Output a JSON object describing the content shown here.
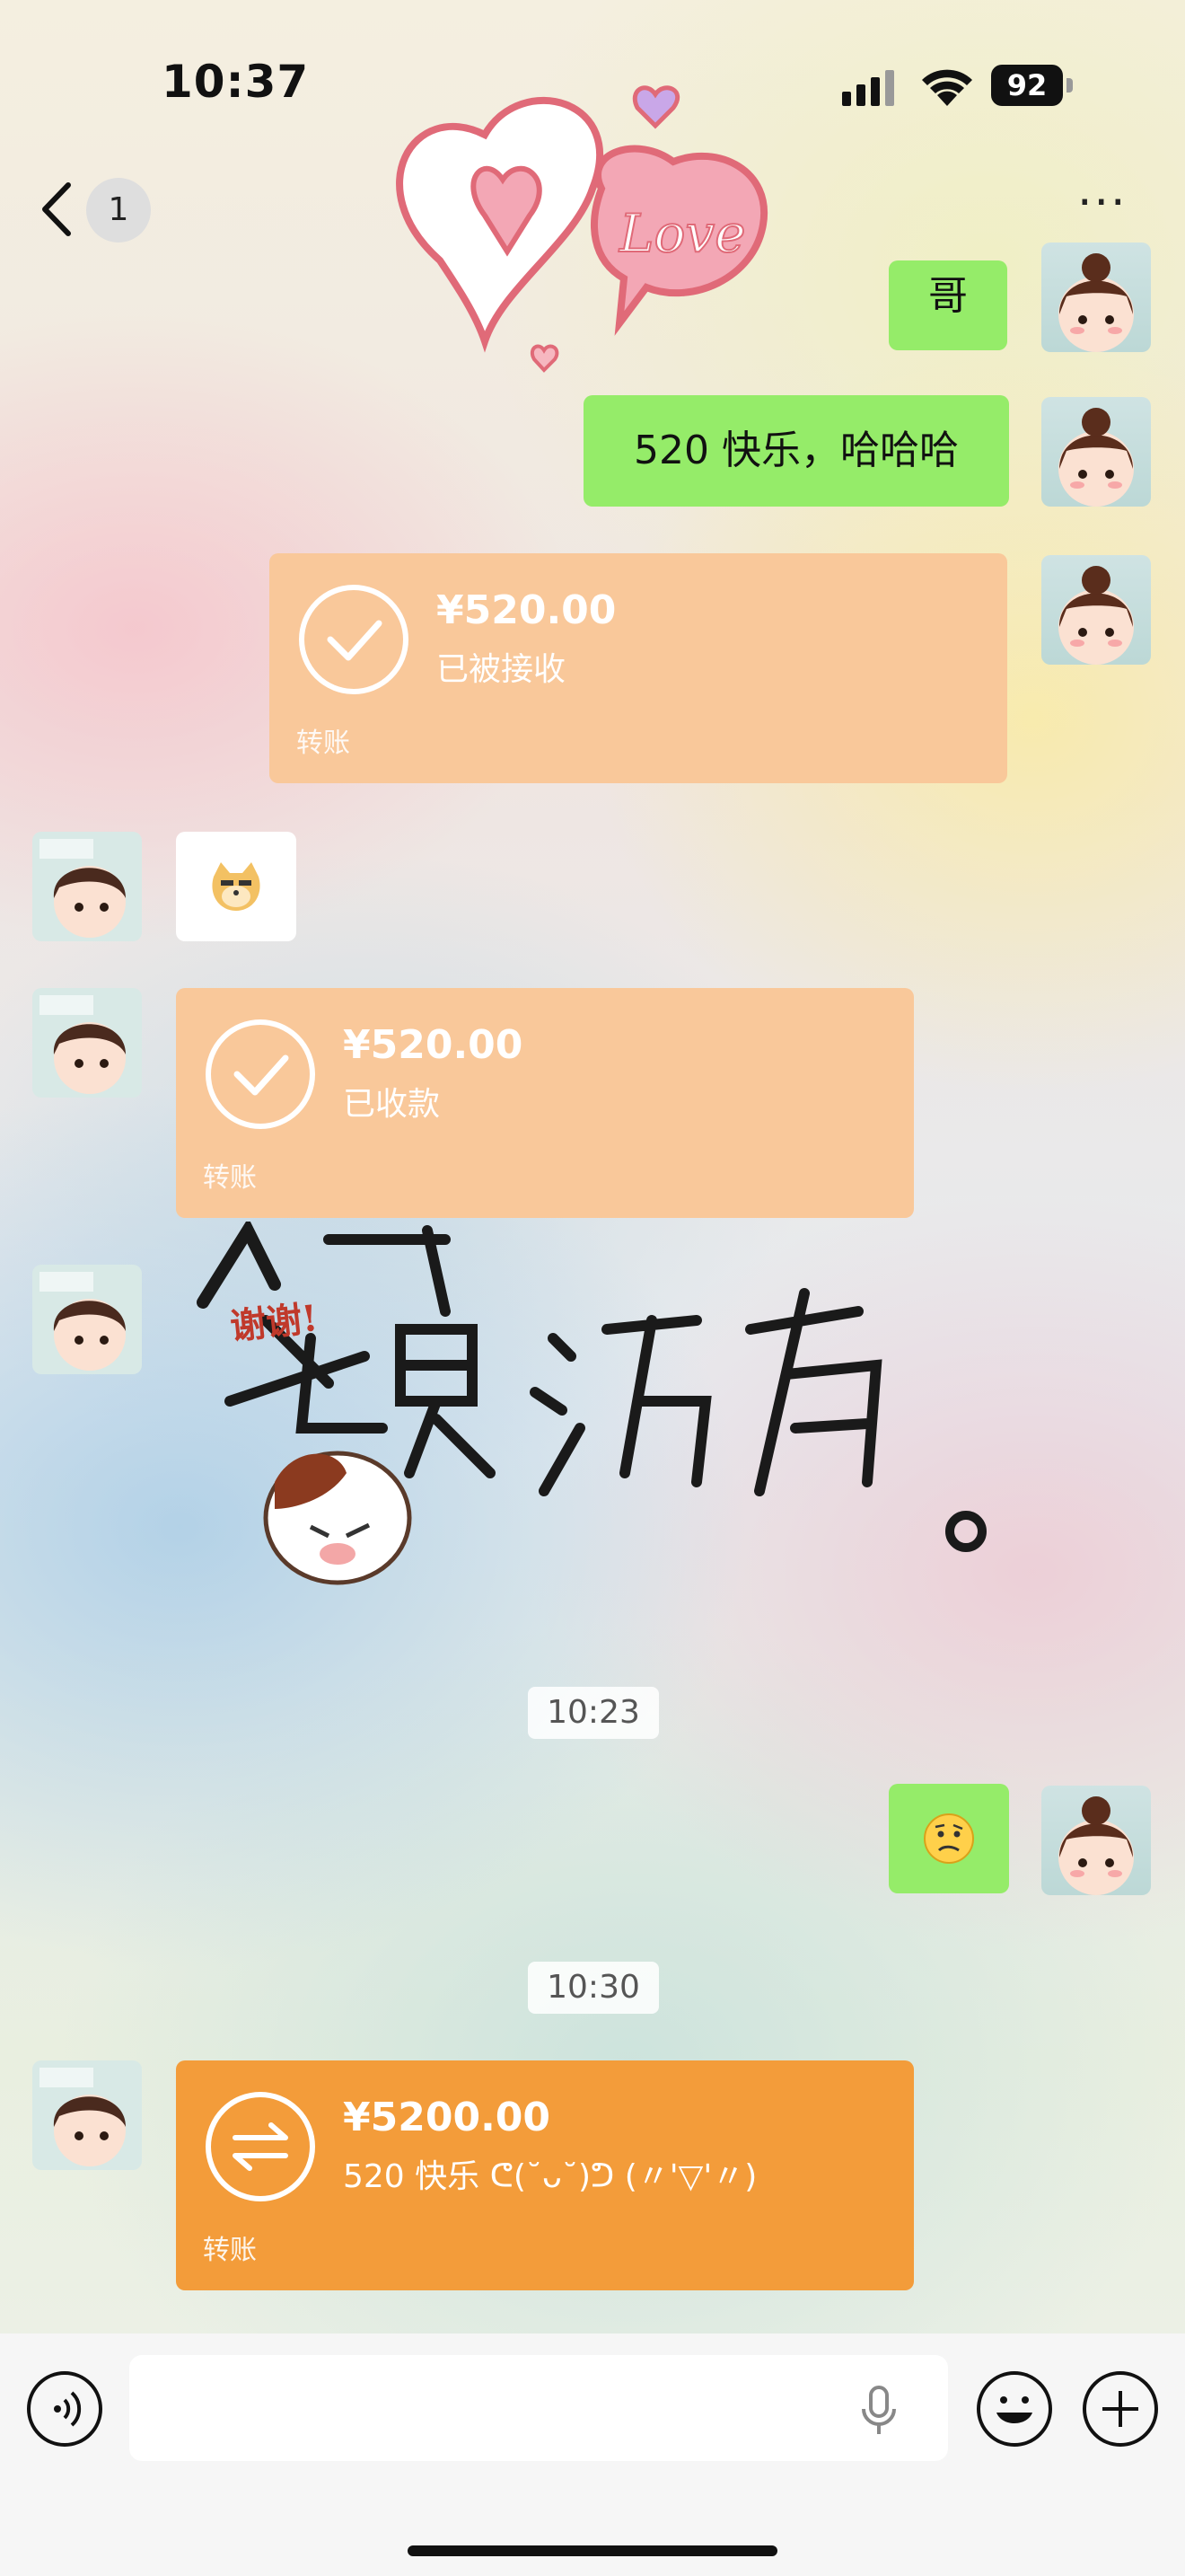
{
  "status_bar": {
    "time": "10:37",
    "battery": "92"
  },
  "nav": {
    "unread_count": "1",
    "more_icon": "more-dots-icon"
  },
  "messages": {
    "m1_text": "哥",
    "m2_text": "520 快乐，哈哈哈",
    "m3_amount": "¥520.00",
    "m3_status": "已被接收",
    "m3_label": "转账",
    "m5_amount": "¥520.00",
    "m5_status": "已收款",
    "m5_label": "转账",
    "sticker_caption": "谢谢!",
    "sticker_text": "也是活着。",
    "time_1": "10:23",
    "time_2": "10:30",
    "m8_amount": "¥5200.00",
    "m8_status": "520 快乐 ᕦ(˘ᴗ˘)ᕤ  (〃'▽'〃)",
    "m8_label": "转账"
  },
  "colors": {
    "green_bubble": "#95ec69",
    "transfer_received": "#f9c89a",
    "transfer_pending": "#f39c3a"
  }
}
